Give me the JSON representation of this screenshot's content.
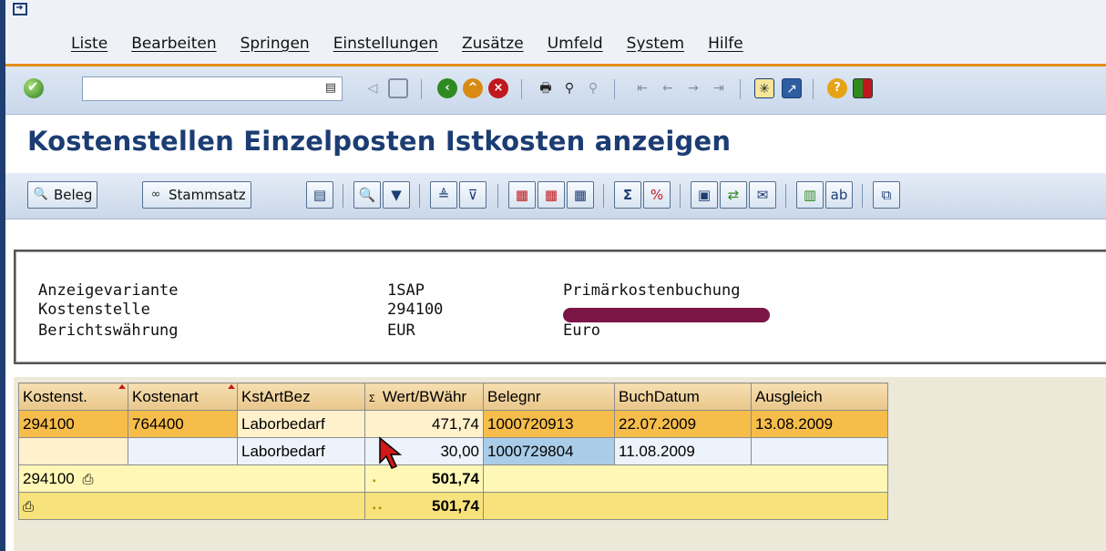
{
  "menu": {
    "items": [
      "Liste",
      "Bearbeiten",
      "Springen",
      "Einstellungen",
      "Zusätze",
      "Umfeld",
      "System",
      "Hilfe"
    ]
  },
  "toolbar": {
    "command_value": "",
    "icons": [
      "enter-icon",
      "back-icon",
      "exit-icon",
      "cancel-icon",
      "print-icon",
      "find-icon",
      "find-next-icon",
      "first-page-icon",
      "prev-page-icon",
      "next-page-icon",
      "last-page-icon",
      "new-session-icon",
      "shortcut-icon",
      "help-icon",
      "layout-icon"
    ]
  },
  "page": {
    "title": "Kostenstellen Einzelposten Istkosten anzeigen"
  },
  "app_toolbar": {
    "beleg_label": "Beleg",
    "stammsatz_label": "Stammsatz"
  },
  "header": {
    "rows": [
      {
        "label": "Anzeigevariante",
        "code": "1SAP",
        "desc": "Primärkostenbuchung"
      },
      {
        "label": "Kostenstelle",
        "code": "294100",
        "desc": ""
      },
      {
        "label": "Berichtswährung",
        "code": "EUR",
        "desc": "Euro"
      }
    ]
  },
  "table": {
    "columns": [
      "Kostenst.",
      "Kostenart",
      "KstArtBez",
      "Wert/BWähr",
      "Belegnr",
      "BuchDatum",
      "Ausgleich"
    ],
    "sum_column_marker": "Σ",
    "rows": [
      {
        "kostenst": "294100",
        "kostenart": "764400",
        "kstartbez": "Laborbedarf",
        "wert": "471,74",
        "belegnr": "1000720913",
        "buchdatum": "22.07.2009",
        "ausgleich": "13.08.2009"
      },
      {
        "kostenst": "",
        "kostenart": "",
        "kstartbez": "Laborbedarf",
        "wert": "30,00",
        "belegnr": "1000729804",
        "buchdatum": "11.08.2009",
        "ausgleich": ""
      }
    ],
    "subtotal": {
      "label": "294100",
      "marker": "▪",
      "value": "501,74"
    },
    "total": {
      "marker": "▪ ▪",
      "value": "501,74"
    }
  },
  "colors": {
    "title": "#1c3d73",
    "selected_row": "#f6bd4b",
    "subtotal_row": "#fff7b6",
    "total_row": "#f7e27b",
    "highlight_cell": "#a9cde9"
  }
}
